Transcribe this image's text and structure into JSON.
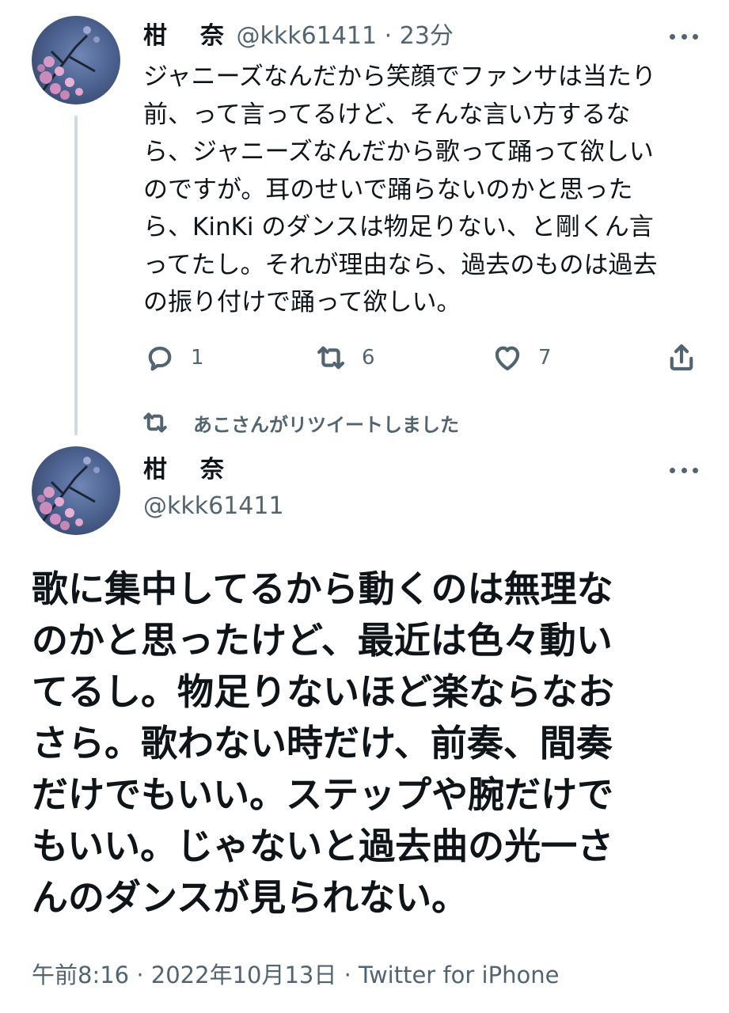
{
  "reply_tweet": {
    "display_name": "柑　奈",
    "handle": "@kkk61411",
    "separator": "·",
    "time_ago": "23分",
    "text": "ジャニーズなんだから笑顔でファンサは当たり\n前、って言ってるけど、そんな言い方するな\nら、ジャニーズなんだから歌って踊って欲しい\nのですが。耳のせいで踊らないのかと思った\nら、KinKi のダンスは物足りない、と剛くん言\nってたし。それが理由なら、過去のものは過去\nの振り付けで踊って欲しい。",
    "actions": {
      "reply": {
        "icon": "reply-icon",
        "count": "1"
      },
      "retweet": {
        "icon": "retweet-icon",
        "count": "6"
      },
      "like": {
        "icon": "heart-icon",
        "count": "7"
      },
      "share": {
        "icon": "share-icon"
      }
    }
  },
  "retweet_notice": {
    "icon": "retweet-icon",
    "text": "あこさんがリツイートしました"
  },
  "main_tweet": {
    "display_name": "柑　奈",
    "handle": "@kkk61411",
    "text": "歌に集中してるから動くのは無理な\nのかと思ったけど、最近は色々動い\nてるし。物足りないほど楽ならなお\nさら。歌わない時だけ、前奏、間奏\nだけでもいい。ステップや腕だけで\nもいい。じゃないと過去曲の光一さ\nんのダンスが見られない。",
    "meta": "午前8:16 · 2022年10月13日 · Twitter for iPhone"
  },
  "colors": {
    "text_primary": "#0f1419",
    "text_secondary": "#536471",
    "thread_line": "#cfd9de",
    "background": "#ffffff"
  }
}
